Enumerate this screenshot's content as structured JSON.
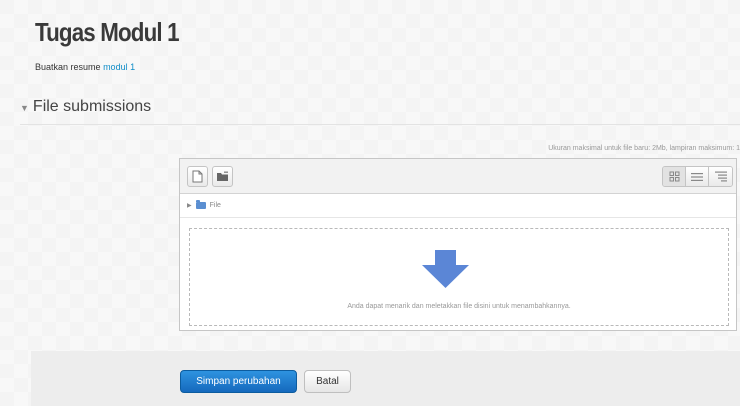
{
  "assignment": {
    "title": "Tugas Modul 1",
    "description_prefix": "Buatkan resume",
    "description_link": "modul 1"
  },
  "section": {
    "heading": "File submissions",
    "expanded": true
  },
  "file_picker": {
    "limit_text": "Ukuran maksimal untuk file baru: 2Mb, lampiran maksimum: 1",
    "path_label": "File",
    "drop_text": "Anda dapat menarik dan meletakkan file disini untuk menambahkannya.",
    "toolbar": {
      "add_icon": "add-file-icon",
      "folder_icon": "create-folder-icon",
      "views": [
        "icons-view-icon",
        "list-view-icon",
        "tree-view-icon"
      ]
    },
    "colors": {
      "arrow": "#5b86d6"
    }
  },
  "actions": {
    "save_label": "Simpan perubahan",
    "cancel_label": "Batal",
    "primary_color": "#1f7bd0"
  }
}
